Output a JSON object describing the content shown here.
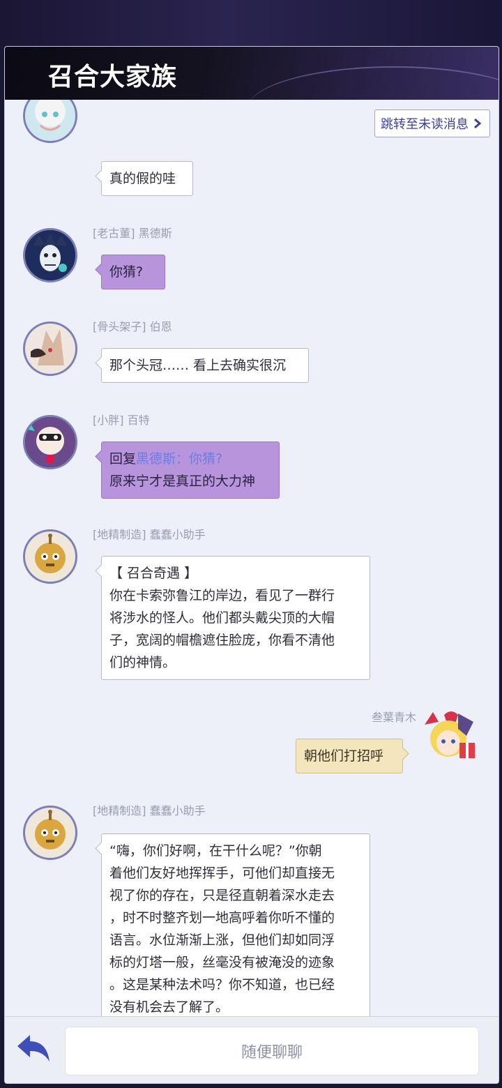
{
  "header": {
    "title": "召合大家族"
  },
  "jump_button": {
    "label": "跳转至未读消息"
  },
  "messages": [
    {
      "text": "真的假的哇"
    },
    {
      "name": "[老古董] 黑德斯",
      "text": "你猜?"
    },
    {
      "name": "[骨头架子] 伯恩",
      "text": "那个头冠…… 看上去确实很沉"
    },
    {
      "name": "[小胖] 百特",
      "reply_prefix": "回复",
      "reply_ref": "黑德斯：你猜?",
      "text": "原来宁才是真正的大力神"
    },
    {
      "name": "[地精制造] 蠢蠢小助手",
      "lines": [
        "【 召合奇遇 】",
        "你在卡索弥鲁江的岸边，看见了一群行",
        "将涉水的怪人。他们都头戴尖顶的大帽",
        "子，宽阔的帽檐遮住脸庞，你看不清他",
        "们的神情。"
      ]
    },
    {
      "name": "叁葉青木",
      "text": "朝他们打招呼"
    },
    {
      "name": "[地精制造] 蠢蠢小助手",
      "lines": [
        "“嗨，你们好啊，在干什么呢？”你朝",
        "着他们友好地挥挥手，可他们却直接无",
        "视了你的存在，只是径直朝着深水走去",
        "，时不时整齐划一地高呼着你听不懂的",
        "语言。水位渐渐上涨，但他们却如同浮",
        "标的灯塔一般，丝毫没有被淹没的迹象",
        "。这是某种法术吗？你不知道，也已经",
        "没有机会去了解了。"
      ]
    }
  ],
  "input": {
    "placeholder": "随便聊聊"
  },
  "icons": {
    "back": "back-arrow-icon",
    "jump": "chevron-right-icon"
  },
  "colors": {
    "accent": "#3d3f9a",
    "purple_bubble": "#b894dd",
    "yellow_bubble": "#f3e6bc",
    "back_icon": "#3f4fb8"
  }
}
